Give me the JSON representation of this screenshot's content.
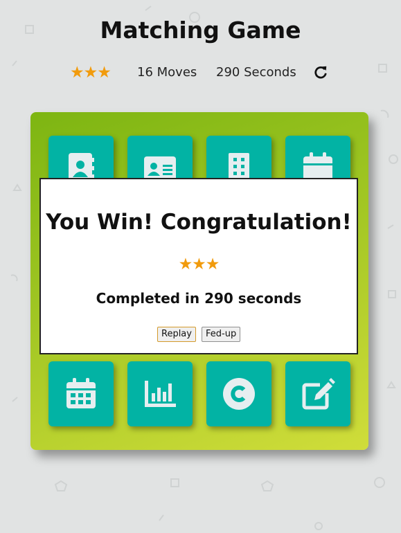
{
  "header": {
    "title": "Matching Game"
  },
  "score_panel": {
    "stars": "★★★",
    "star_count": 3,
    "moves": "16 Moves",
    "seconds": "290 Seconds",
    "restart_icon": "redo-icon"
  },
  "deck": {
    "gradient_colors": [
      "#7db512",
      "#d0dd3a"
    ],
    "card_color": "#02b3a4",
    "cards": [
      {
        "icon": "address-book-icon"
      },
      {
        "icon": "address-card-icon"
      },
      {
        "icon": "building-icon"
      },
      {
        "icon": "calendar-icon"
      },
      {
        "icon": "calendar-alt-icon"
      },
      {
        "icon": "chart-bar-icon"
      },
      {
        "icon": "copyright-icon"
      },
      {
        "icon": "edit-icon"
      }
    ]
  },
  "modal": {
    "title": "You Win! Congratulation!",
    "stars": "★★★",
    "completed_text": "Completed in 290 seconds",
    "replay_label": "Replay",
    "fedup_label": "Fed-up"
  },
  "colors": {
    "star": "#f19b0d",
    "background": "#e1e3e3"
  }
}
